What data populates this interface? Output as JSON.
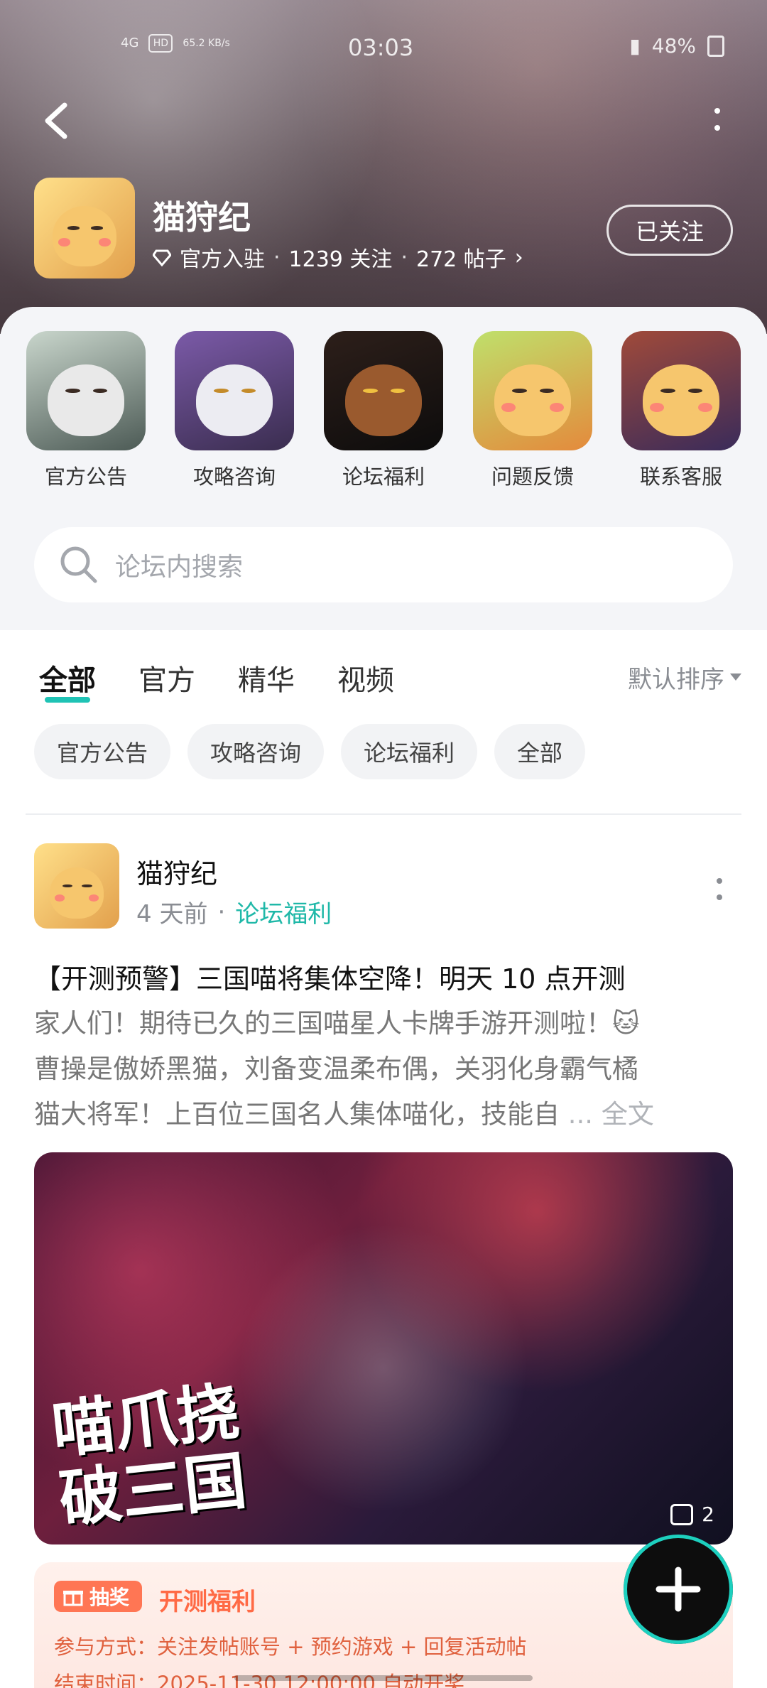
{
  "status_bar": {
    "network": "4G",
    "hd": "HD",
    "speed": "65.2 KB/s",
    "time": "03:03",
    "battery": "48%"
  },
  "forum": {
    "name": "猫狩纪",
    "official_label": "官方入驻",
    "followers": "1239 关注",
    "posts": "272 帖子",
    "follow_button": "已关注"
  },
  "quick_links": [
    {
      "label": "官方公告"
    },
    {
      "label": "攻略咨询"
    },
    {
      "label": "论坛福利"
    },
    {
      "label": "问题反馈"
    },
    {
      "label": "联系客服"
    }
  ],
  "search": {
    "placeholder": "论坛内搜索"
  },
  "tabs": [
    {
      "label": "全部",
      "active": true
    },
    {
      "label": "官方"
    },
    {
      "label": "精华"
    },
    {
      "label": "视频"
    }
  ],
  "sort": {
    "label": "默认排序"
  },
  "chips": [
    "官方公告",
    "攻略咨询",
    "论坛福利",
    "全部"
  ],
  "post": {
    "author": "猫狩纪",
    "time": "4 天前",
    "tag": "论坛福利",
    "title": "【开测预警】三国喵将集体空降！明天 10 点开测",
    "body_lines": [
      "家人们！期待已久的三国喵星人卡牌手游开测啦！🐱",
      "曹操是傲娇黑猫，刘备变温柔布偶，关羽化身霸气橘",
      "猫大将军！上百位三国名人集体喵化，技能自"
    ],
    "ellipsis": "...",
    "full_text_link": "全文",
    "image": {
      "calligraphy_line1": "喵爪挠",
      "calligraphy_line2": "破三国",
      "count": "2"
    },
    "promo": {
      "badge": "抽奖",
      "title": "开测福利",
      "line1": "参与方式：关注发帖账号 + 预约游戏 + 回复活动帖",
      "line2": "结束时间：2025-11-30 12:00:00 自动开奖"
    }
  },
  "colors": {
    "accent": "#1fc3b5",
    "promo": "#ff6a45"
  }
}
